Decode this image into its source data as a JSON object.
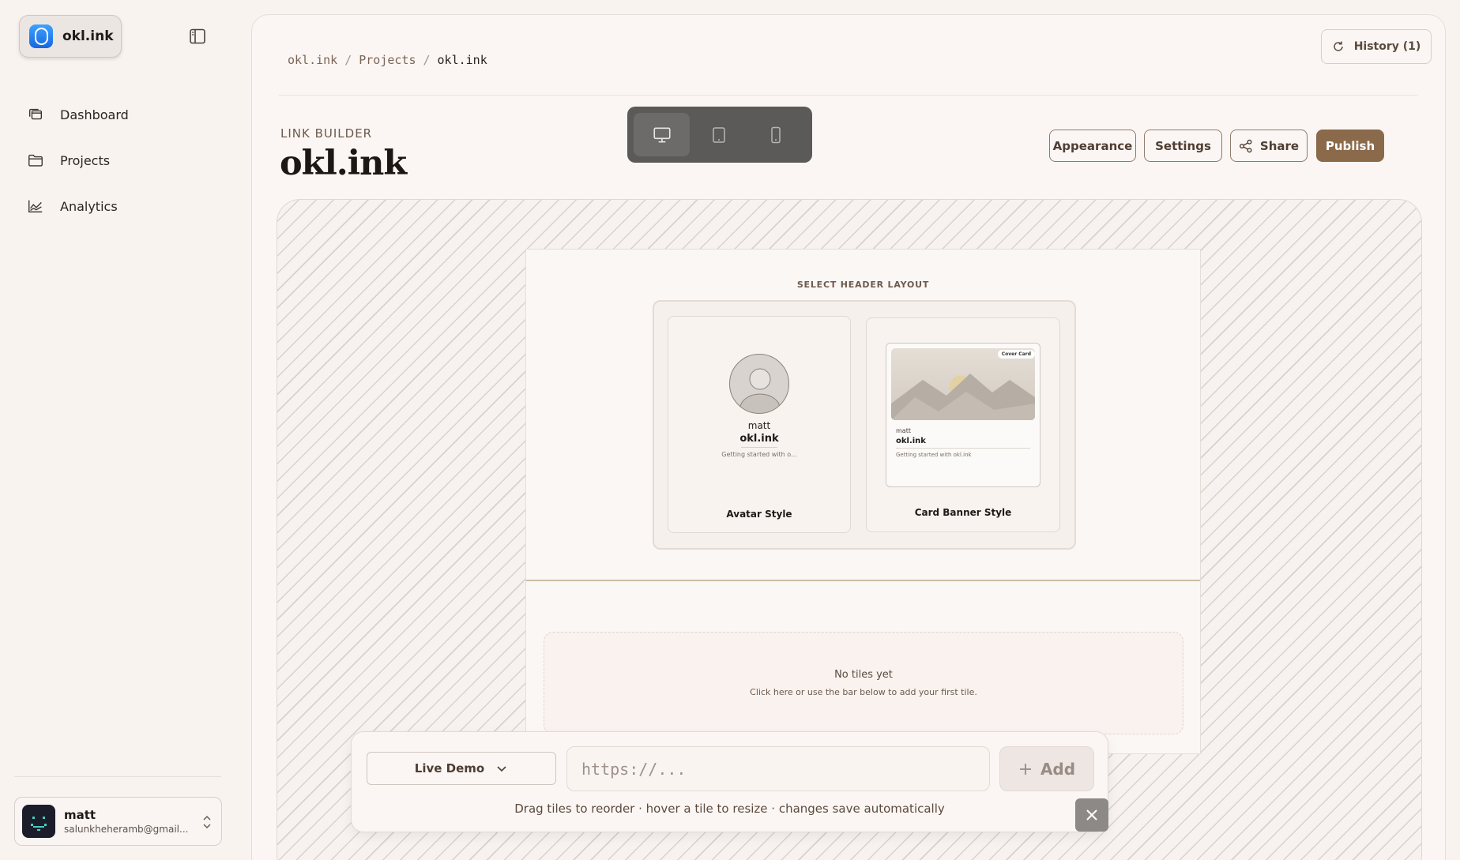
{
  "sidebar": {
    "brand": {
      "name": "okl.ink",
      "logo_letter": "O"
    },
    "items": [
      {
        "label": "Dashboard",
        "icon": "layers-icon"
      },
      {
        "label": "Projects",
        "icon": "folder-icon"
      },
      {
        "label": "Analytics",
        "icon": "chart-line-icon"
      }
    ],
    "user": {
      "name": "matt",
      "email": "salunkheheramb@gmail..."
    }
  },
  "header": {
    "history_label": "History (1)",
    "breadcrumb": [
      "okl.ink",
      "Projects",
      "okl.ink"
    ],
    "kicker": "LINK BUILDER",
    "title": "okl.ink",
    "actions": {
      "appearance": "Appearance",
      "settings": "Settings",
      "share": "Share",
      "publish": "Publish"
    }
  },
  "preview": {
    "select_title": "SELECT HEADER LAYOUT",
    "avatar_card": {
      "name": "matt",
      "title": "okl.ink",
      "desc": "Getting started with o...",
      "label": "Avatar Style"
    },
    "banner_card": {
      "tag": "Cover Card",
      "name": "matt",
      "title": "okl.ink",
      "desc": "Getting started with okl.ink",
      "label": "Card Banner Style"
    },
    "empty": {
      "title": "No tiles yet",
      "subtitle": "Click here or use the bar below to add your first tile."
    }
  },
  "add_bar": {
    "mode": "Live Demo",
    "url_placeholder": "https://...",
    "add_label": "Add",
    "hint": "Drag tiles to reorder · hover a tile to resize · changes save automatically"
  },
  "colors": {
    "accent": "#8a6a4a",
    "background": "#f9f3f0",
    "brand_blue": "#1f7af0"
  }
}
